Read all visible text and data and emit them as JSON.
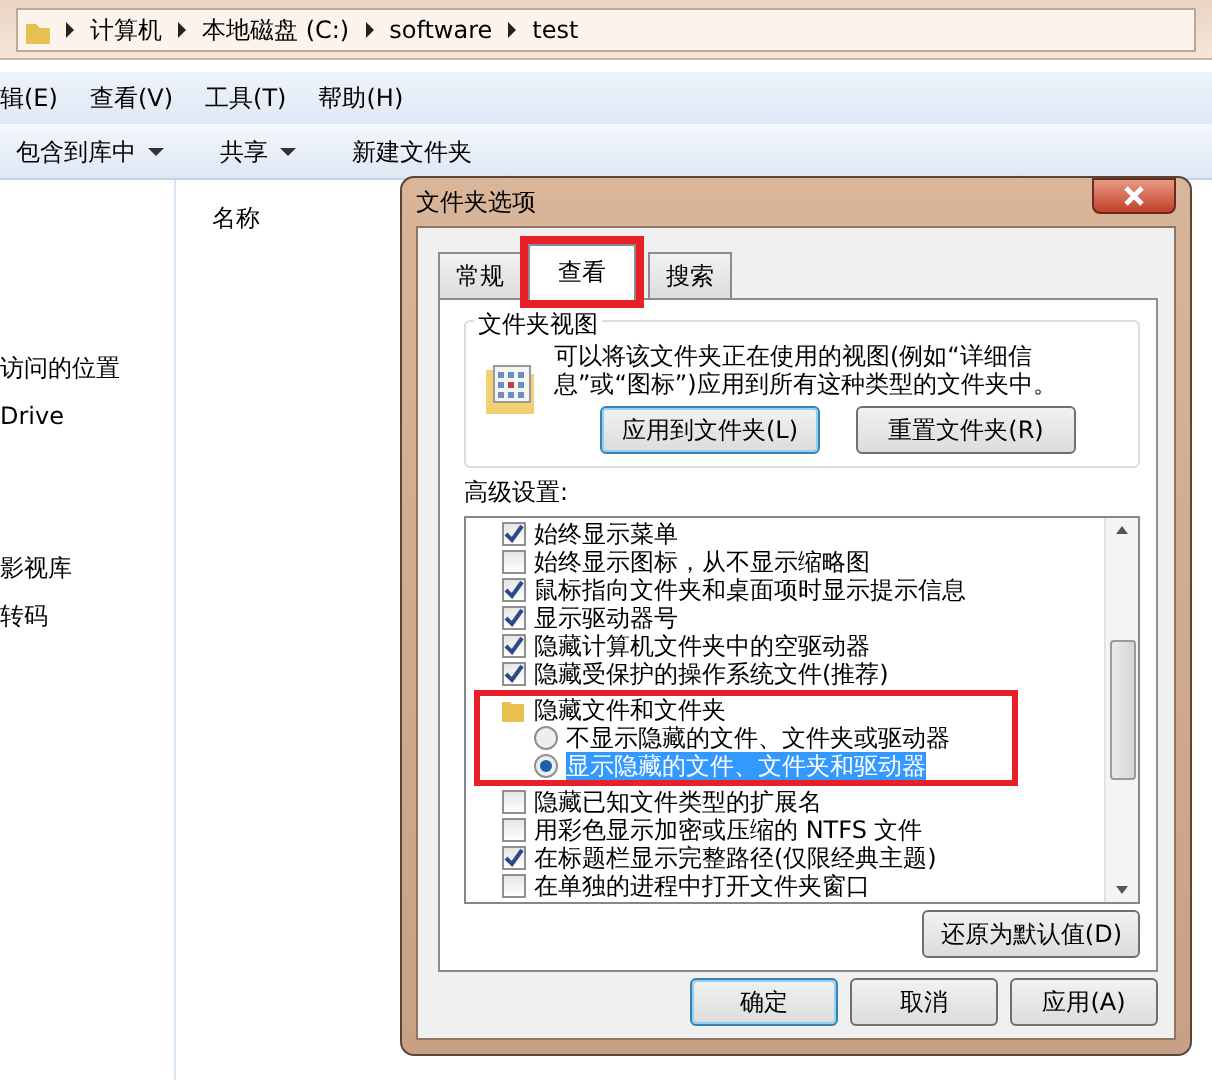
{
  "explorer": {
    "breadcrumbs": [
      "计算机",
      "本地磁盘 (C:)",
      "software",
      "test"
    ],
    "menu": [
      "辑(E)",
      "查看(V)",
      "工具(T)",
      "帮助(H)"
    ],
    "toolbar": [
      {
        "label": "包含到库中",
        "dropdown": true
      },
      {
        "label": "共享",
        "dropdown": true
      },
      {
        "label": "新建文件夹",
        "dropdown": false
      }
    ],
    "nav_groups": [
      [
        "访问的位置",
        "Drive"
      ],
      [
        "影视库",
        "转码"
      ]
    ],
    "column_header": "名称"
  },
  "dialog": {
    "title": "文件夹选项",
    "tabs": [
      {
        "label": "常规",
        "selected": false,
        "highlighted": false
      },
      {
        "label": "查看",
        "selected": true,
        "highlighted": true
      },
      {
        "label": "搜索",
        "selected": false,
        "highlighted": false
      }
    ],
    "folder_views": {
      "legend": "文件夹视图",
      "description": "可以将该文件夹正在使用的视图(例如“详细信息”或“图标”)应用到所有这种类型的文件夹中。",
      "buttons": [
        "应用到文件夹(L)",
        "重置文件夹(R)"
      ]
    },
    "advanced_label": "高级设置:",
    "settings": [
      {
        "kind": "checkbox",
        "label": "始终显示菜单",
        "checked": true
      },
      {
        "kind": "checkbox",
        "label": "始终显示图标，从不显示缩略图",
        "checked": false
      },
      {
        "kind": "checkbox",
        "label": "鼠标指向文件夹和桌面项时显示提示信息",
        "checked": true
      },
      {
        "kind": "checkbox",
        "label": "显示驱动器号",
        "checked": true
      },
      {
        "kind": "checkbox",
        "label": "隐藏计算机文件夹中的空驱动器",
        "checked": true
      },
      {
        "kind": "checkbox",
        "label": "隐藏受保护的操作系统文件(推荐)",
        "checked": true
      },
      {
        "kind": "folder",
        "label": "隐藏文件和文件夹",
        "highlighted": true,
        "children": [
          {
            "kind": "radio",
            "label": "不显示隐藏的文件、文件夹或驱动器",
            "selected": false
          },
          {
            "kind": "radio",
            "label": "显示隐藏的文件、文件夹和驱动器",
            "selected": true
          }
        ]
      },
      {
        "kind": "checkbox",
        "label": "隐藏已知文件类型的扩展名",
        "checked": false
      },
      {
        "kind": "checkbox",
        "label": "用彩色显示加密或压缩的 NTFS 文件",
        "checked": false
      },
      {
        "kind": "checkbox",
        "label": "在标题栏显示完整路径(仅限经典主题)",
        "checked": true
      },
      {
        "kind": "checkbox",
        "label": "在单独的进程中打开文件夹窗口",
        "checked": false
      }
    ],
    "restore_button": "还原为默认值(D)",
    "buttons": [
      "确定",
      "取消",
      "应用(A)"
    ]
  }
}
